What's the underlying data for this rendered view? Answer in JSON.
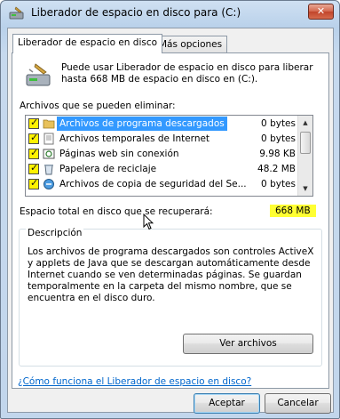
{
  "window": {
    "title": "Liberador de espacio en disco para  (C:)"
  },
  "tabs": [
    {
      "label": "Liberador de espacio en disco"
    },
    {
      "label": "Más opciones"
    }
  ],
  "intro": "Puede usar Liberador de espacio en disco para liberar hasta 668 MB de espacio en disco en  (C:).",
  "files_label": "Archivos que se pueden eliminar:",
  "files": [
    {
      "name": "Archivos de programa descargados",
      "size": "0 bytes",
      "checked": true,
      "icon": "folder-icon"
    },
    {
      "name": "Archivos temporales de Internet",
      "size": "0 bytes",
      "checked": true,
      "icon": "internet-file-icon"
    },
    {
      "name": "Páginas web sin conexión",
      "size": "9.98 KB",
      "checked": true,
      "icon": "offline-pages-icon"
    },
    {
      "name": "Papelera de reciclaje",
      "size": "48.2 MB",
      "checked": true,
      "icon": "recycle-bin-icon"
    },
    {
      "name": "Archivos de copia de seguridad del Se...",
      "size": "0 bytes",
      "checked": true,
      "icon": "backup-icon"
    }
  ],
  "total": {
    "label": "Espacio total en disco que se recuperará:",
    "value": "668 MB"
  },
  "description": {
    "title": "Descripción",
    "text": "Los archivos de programa descargados son controles ActiveX y applets de Java que se descargan automáticamente desde Internet cuando se ven determinadas páginas. Se guardan temporalmente en la carpeta del mismo nombre, que se encuentra en el disco duro.",
    "view_button": "Ver archivos"
  },
  "help_link": "¿Cómo funciona el Liberador de espacio en disco?",
  "buttons": {
    "ok": "Aceptar",
    "cancel": "Cancelar"
  },
  "colors": {
    "selection": "#3399ff",
    "highlight": "#ffff33",
    "link": "#0066cc"
  }
}
